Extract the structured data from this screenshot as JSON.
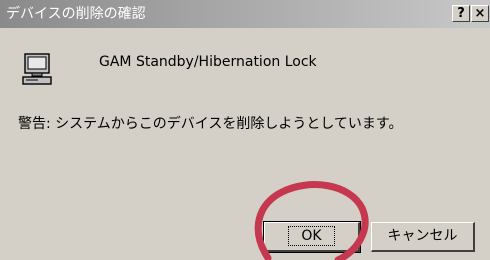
{
  "dialog": {
    "title": "デバイスの削除の確認",
    "help_button": "?",
    "close_button": "×",
    "device_icon": "computer-icon",
    "device_name": "GAM Standby/Hibernation Lock",
    "warning_text": "警告: システムからこのデバイスを削除しようとしています。",
    "ok_label": "OK",
    "cancel_label": "キャンセル"
  },
  "annotation": {
    "color": "#c5384f",
    "shape": "circle"
  }
}
